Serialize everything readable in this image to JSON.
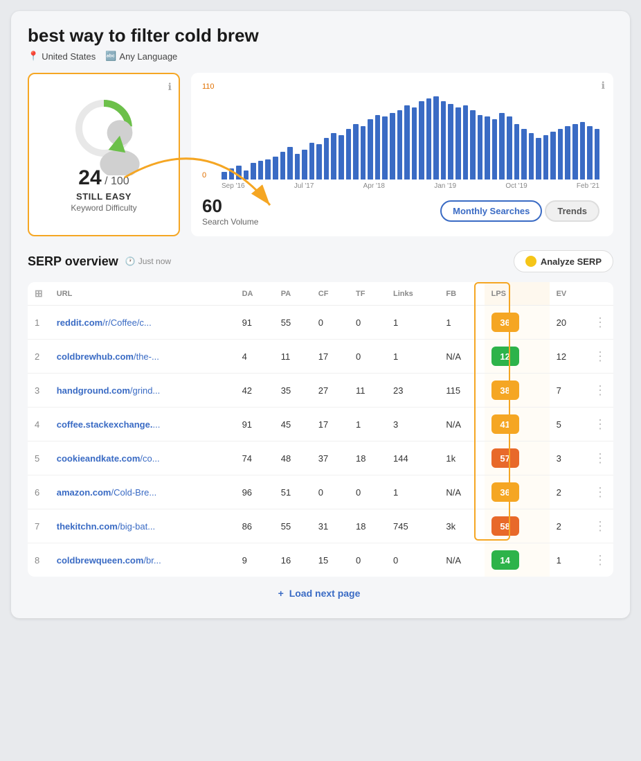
{
  "page": {
    "title": "best way to filter cold brew",
    "location": "United States",
    "language": "Any Language",
    "location_icon": "📍",
    "language_icon": "🔤"
  },
  "difficulty": {
    "score": "24",
    "max": "100",
    "label": "STILL EASY",
    "sublabel": "Keyword Difficulty",
    "info_icon": "ℹ"
  },
  "chart": {
    "y_max": "110",
    "y_min": "0",
    "x_labels": [
      "Sep '16",
      "Jul '17",
      "Apr '18",
      "Jan '19",
      "Oct '19",
      "Feb '21"
    ],
    "search_volume": "60",
    "search_volume_label": "Search Volume",
    "bars": [
      8,
      12,
      15,
      10,
      18,
      20,
      22,
      25,
      30,
      35,
      28,
      32,
      40,
      38,
      45,
      50,
      48,
      55,
      60,
      58,
      65,
      70,
      68,
      72,
      75,
      80,
      78,
      85,
      88,
      90,
      85,
      82,
      78,
      80,
      75,
      70,
      68,
      65,
      72,
      68,
      60,
      55,
      50,
      45,
      48,
      52,
      55,
      58,
      60,
      62,
      58,
      55
    ],
    "info_icon": "ℹ",
    "tabs": [
      {
        "label": "Monthly Searches",
        "active": true
      },
      {
        "label": "Trends",
        "active": false
      }
    ]
  },
  "serp": {
    "title": "SERP overview",
    "time_label": "Just now",
    "analyze_btn": "Analyze SERP",
    "columns": [
      "",
      "URL",
      "DA",
      "PA",
      "CF",
      "TF",
      "Links",
      "FB",
      "LPS",
      "EV",
      ""
    ],
    "rows": [
      {
        "rank": "1",
        "url_domain": "reddit.com",
        "url_path": "/r/Coffee/c...",
        "da": "91",
        "pa": "55",
        "cf": "0",
        "tf": "0",
        "links": "1",
        "fb": "1",
        "lps": "36",
        "lps_color": "#f5a623",
        "ev": "20"
      },
      {
        "rank": "2",
        "url_domain": "coldbrewhub.com",
        "url_path": "/the-...",
        "da": "4",
        "pa": "11",
        "cf": "17",
        "tf": "0",
        "links": "1",
        "fb": "N/A",
        "lps": "12",
        "lps_color": "#2db34a",
        "ev": "12"
      },
      {
        "rank": "3",
        "url_domain": "handground.com",
        "url_path": "/grind...",
        "da": "42",
        "pa": "35",
        "cf": "27",
        "tf": "11",
        "links": "23",
        "fb": "115",
        "lps": "38",
        "lps_color": "#f5a623",
        "ev": "7"
      },
      {
        "rank": "4",
        "url_domain": "coffee.stackexchange.",
        "url_path": "...",
        "da": "91",
        "pa": "45",
        "cf": "17",
        "tf": "1",
        "links": "3",
        "fb": "N/A",
        "lps": "41",
        "lps_color": "#f5a623",
        "ev": "5"
      },
      {
        "rank": "5",
        "url_domain": "cookieandkate.com",
        "url_path": "/co...",
        "da": "74",
        "pa": "48",
        "cf": "37",
        "tf": "18",
        "links": "144",
        "fb": "1k",
        "lps": "57",
        "lps_color": "#e8692a",
        "ev": "3"
      },
      {
        "rank": "6",
        "url_domain": "amazon.com",
        "url_path": "/Cold-Bre...",
        "da": "96",
        "pa": "51",
        "cf": "0",
        "tf": "0",
        "links": "1",
        "fb": "N/A",
        "lps": "36",
        "lps_color": "#f5a623",
        "ev": "2"
      },
      {
        "rank": "7",
        "url_domain": "thekitchn.com",
        "url_path": "/big-bat...",
        "da": "86",
        "pa": "55",
        "cf": "31",
        "tf": "18",
        "links": "745",
        "fb": "3k",
        "lps": "58",
        "lps_color": "#e8692a",
        "ev": "2"
      },
      {
        "rank": "8",
        "url_domain": "coldbrewqueen.com",
        "url_path": "/br...",
        "da": "9",
        "pa": "16",
        "cf": "15",
        "tf": "0",
        "links": "0",
        "fb": "N/A",
        "lps": "14",
        "lps_color": "#2db34a",
        "ev": "1"
      }
    ],
    "load_next": "Load next page"
  }
}
